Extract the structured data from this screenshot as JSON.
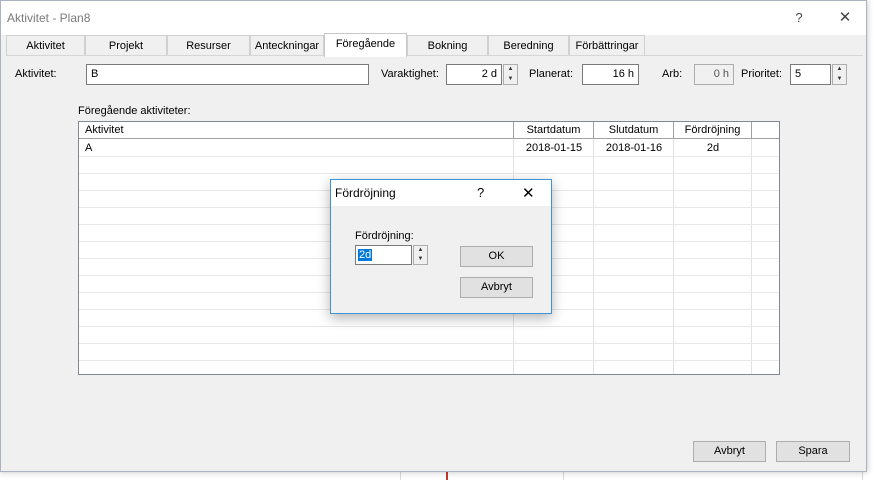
{
  "window": {
    "title": "Aktivitet - Plan8",
    "help_glyph": "?",
    "close_glyph": "✕"
  },
  "tabs": [
    {
      "label": "Aktivitet"
    },
    {
      "label": "Projekt"
    },
    {
      "label": "Resurser"
    },
    {
      "label": "Anteckningar"
    },
    {
      "label": "Föregående"
    },
    {
      "label": "Bokning"
    },
    {
      "label": "Beredning"
    },
    {
      "label": "Förbättringar"
    }
  ],
  "active_tab": "Föregående",
  "form": {
    "aktivitet_label": "Aktivitet:",
    "aktivitet_value": "B",
    "varaktighet_label": "Varaktighet:",
    "varaktighet_value": "2 d",
    "planerat_label": "Planerat:",
    "planerat_value": "16 h",
    "arb_label": "Arb:",
    "arb_value": "0 h",
    "prioritet_label": "Prioritet:",
    "prioritet_value": "5"
  },
  "predecessors": {
    "label": "Föregående aktiviteter:",
    "columns": [
      "Aktivitet",
      "Startdatum",
      "Slutdatum",
      "Fördröjning"
    ],
    "rows": [
      {
        "aktivitet": "A",
        "start": "2018-01-15",
        "slut": "2018-01-16",
        "fordrojning": "2d"
      }
    ]
  },
  "footer": {
    "cancel_label": "Avbryt",
    "save_label": "Spara"
  },
  "dialog": {
    "title": "Fördröjning",
    "help_glyph": "?",
    "close_glyph": "✕",
    "field_label": "Fördröjning:",
    "field_value": "2d",
    "ok_label": "OK",
    "cancel_label": "Avbryt",
    "accent_color": "#3e92d6"
  },
  "icons": {
    "spin_up": "▲",
    "spin_down": "▼"
  }
}
